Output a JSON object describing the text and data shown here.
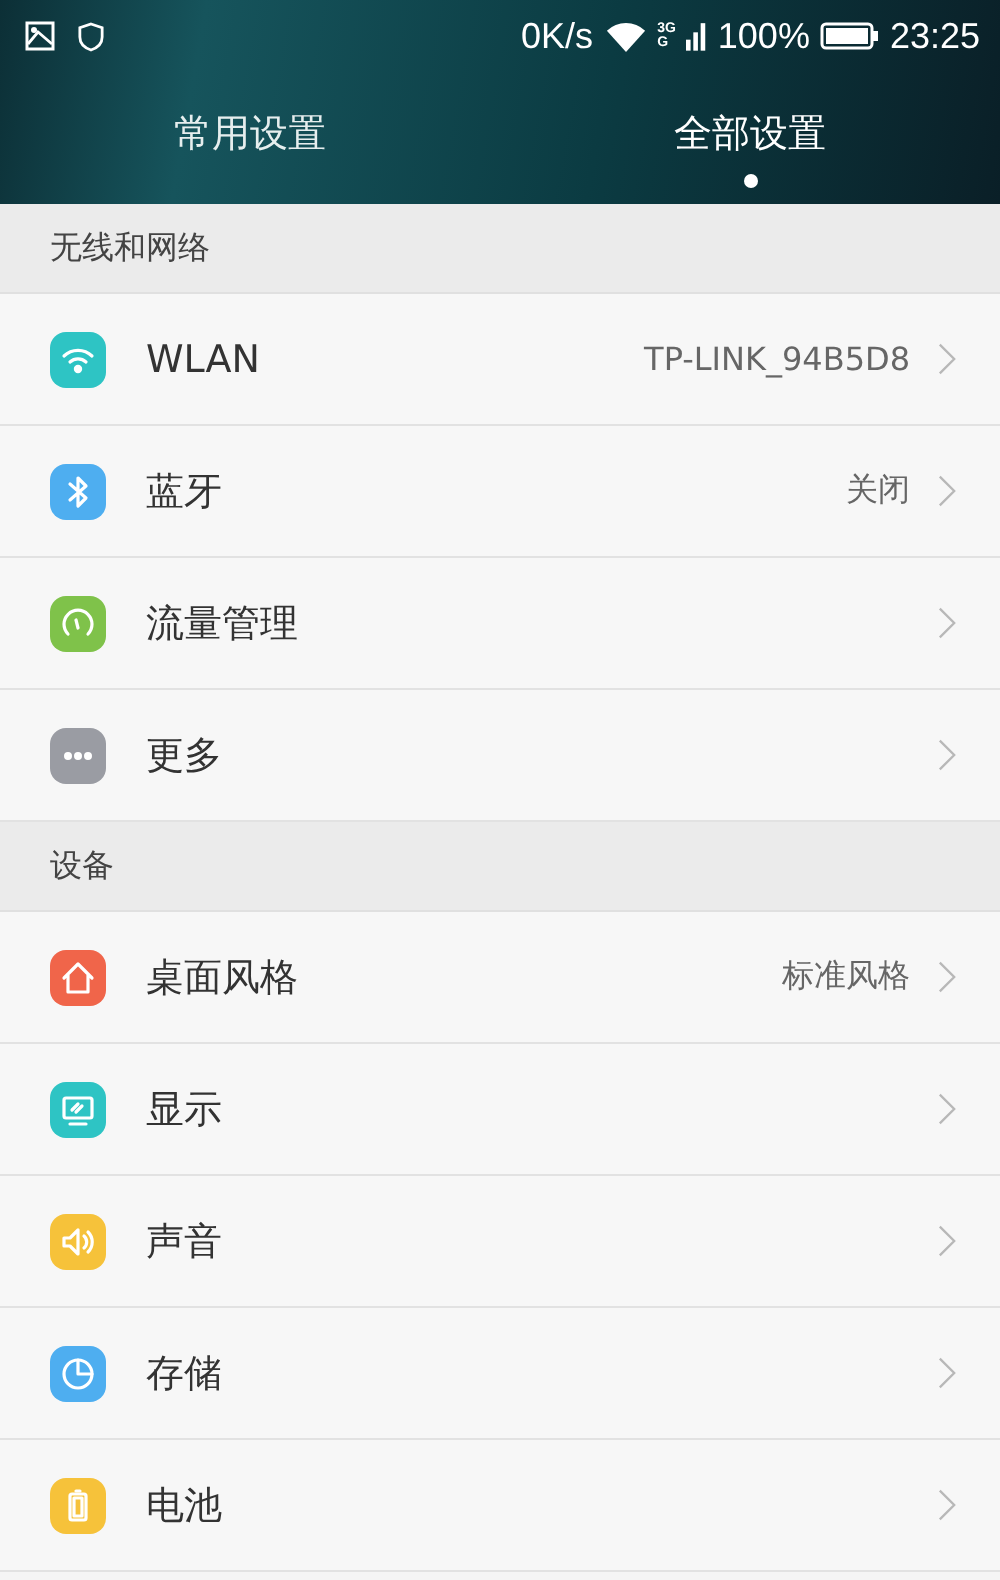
{
  "status_bar": {
    "speed": "0K/s",
    "network_top": "3G",
    "network_bottom": "G",
    "battery": "100%",
    "time": "23:25"
  },
  "tabs": [
    {
      "label": "常用设置",
      "selected": false
    },
    {
      "label": "全部设置",
      "selected": true
    }
  ],
  "sections": [
    {
      "title": "无线和网络",
      "items": [
        {
          "kind": "wifi",
          "color": "#2ec4c4",
          "label": "WLAN",
          "value": "TP-LINK_94B5D8"
        },
        {
          "kind": "bluetooth",
          "color": "#4eaef0",
          "label": "蓝牙",
          "value": "关闭"
        },
        {
          "kind": "traffic",
          "color": "#7fc24a",
          "label": "流量管理"
        },
        {
          "kind": "more",
          "color": "#9a9ca3",
          "label": "更多"
        }
      ]
    },
    {
      "title": "设备",
      "items": [
        {
          "kind": "home",
          "color": "#f0654a",
          "label": "桌面风格",
          "value": "标准风格"
        },
        {
          "kind": "display",
          "color": "#2ec4c4",
          "label": "显示"
        },
        {
          "kind": "sound",
          "color": "#f6c23a",
          "label": "声音"
        },
        {
          "kind": "storage",
          "color": "#4eaef0",
          "label": "存储"
        },
        {
          "kind": "battery",
          "color": "#f6c23a",
          "label": "电池"
        }
      ]
    }
  ]
}
